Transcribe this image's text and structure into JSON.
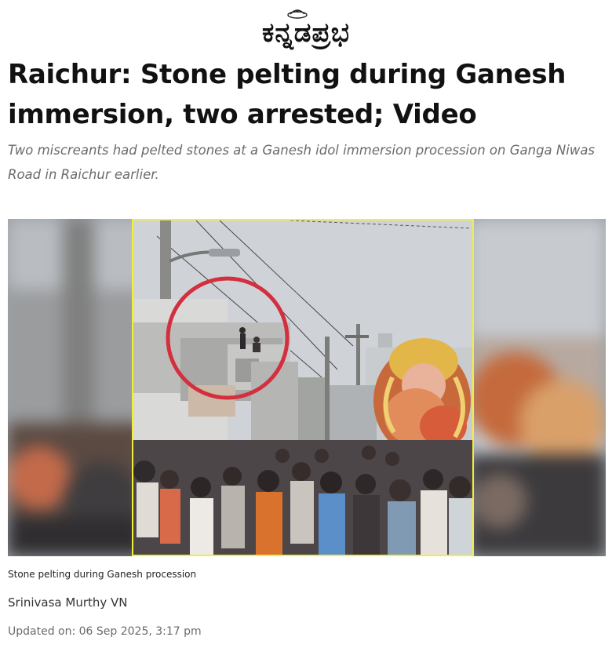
{
  "brand": {
    "name": "ಕನ್ನಡಪ್ರಭ"
  },
  "article": {
    "headline": "Raichur: Stone pelting during Ganesh immersion, two arrested; Video",
    "subheadline": "Two miscreants had pelted stones at a Ganesh idol immersion procession on Ganga Niwas Road in Raichur earlier.",
    "image_caption": "Stone pelting during Ganesh procession",
    "author": "Srinivasa Murthy VN",
    "updated": "Updated on: 06 Sep 2025, 3:17 pm"
  },
  "colors": {
    "highlight_frame": "#f2ef3a",
    "circle_marker": "#d32f3f",
    "text_primary": "#111111",
    "text_muted": "#6b6b6b"
  }
}
